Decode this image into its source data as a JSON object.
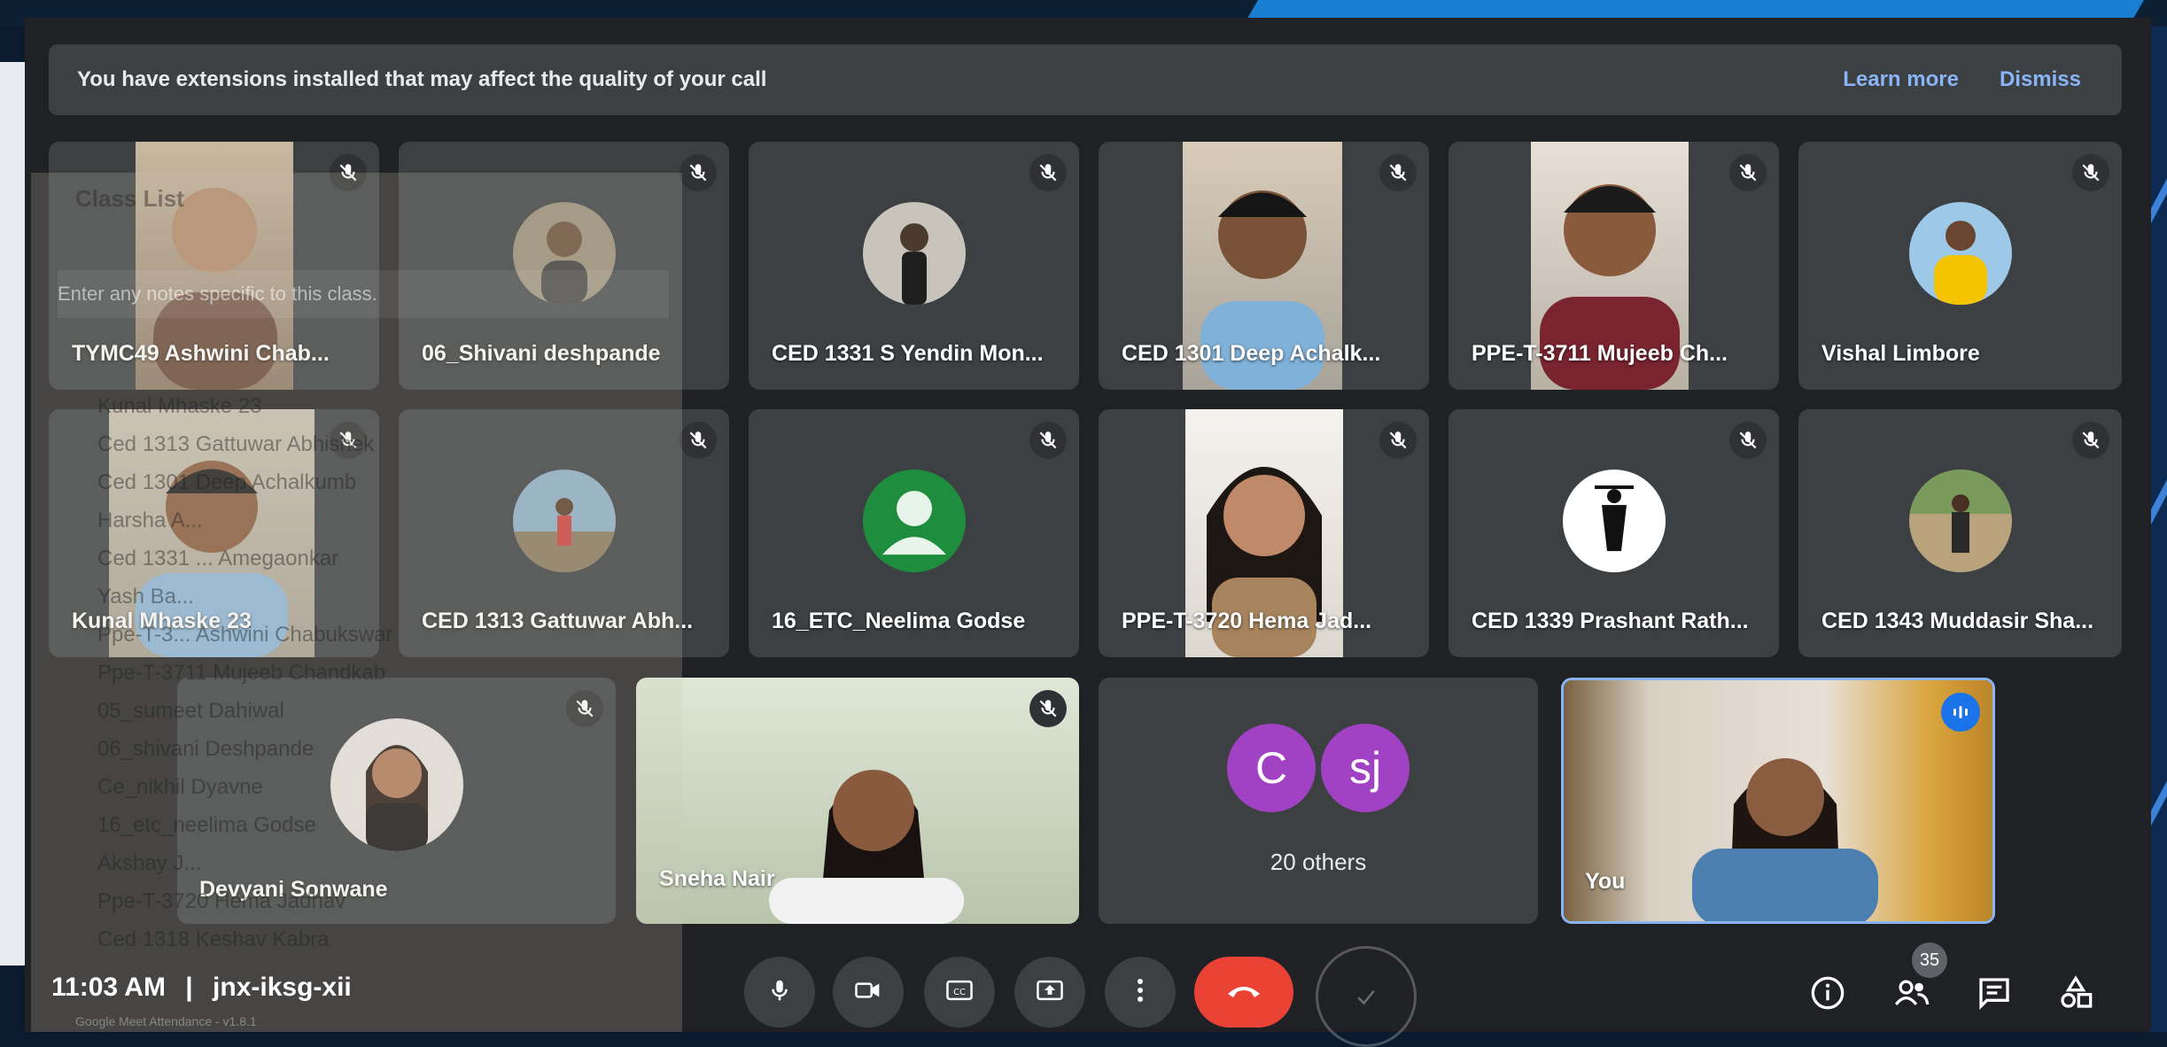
{
  "banner": {
    "message": "You have extensions installed that may affect the quality of your call",
    "learn_more": "Learn more",
    "dismiss": "Dismiss"
  },
  "participants": [
    {
      "name": "TYMC49 Ashwini Chab..."
    },
    {
      "name": "06_Shivani deshpande"
    },
    {
      "name": "CED 1331 S Yendin Mon..."
    },
    {
      "name": "CED 1301 Deep Achalk..."
    },
    {
      "name": "PPE-T-3711 Mujeeb Ch..."
    },
    {
      "name": "Vishal Limbore"
    },
    {
      "name": "Kunal Mhaske 23"
    },
    {
      "name": "CED 1313 Gattuwar Abh..."
    },
    {
      "name": "16_ETC_Neelima Godse"
    },
    {
      "name": "PPE-T-3720 Hema Jad..."
    },
    {
      "name": "CED 1339 Prashant Rath..."
    },
    {
      "name": "CED 1343 Muddasir Sha..."
    },
    {
      "name": "Devyani Sonwane"
    },
    {
      "name": "Sneha Nair"
    }
  ],
  "others": {
    "initials": [
      "C",
      "sj"
    ],
    "label": "20 others"
  },
  "self": {
    "name": "You"
  },
  "meeting": {
    "time": "11:03 AM",
    "separator": "|",
    "code": "jnx-iksg-xii"
  },
  "people_count": "35",
  "overlay": {
    "title": "Class List",
    "notes_placeholder": "Enter any notes specific to this class.",
    "rows": [
      "Kunal Mhaske 23",
      "Ced 1313 Gattuwar Abhishek",
      "Ced 1301 Deep Achalkumb",
      "Harsha A...",
      "Ced 1331 ... Amegaonkar",
      "Yash Ba...",
      "Ppe-T-3... Ashwini Chabukswar",
      "Ppe-T-3711 Mujeeb Chandkab",
      "05_sumeet Dahiwal",
      "06_shivani Deshpande",
      "Ce_nikhil Dyavne",
      "16_etc_neelima Godse",
      "Akshay J...",
      "Ppe-T-3720 Hema Jadhav",
      "Ced 1318 Keshav Kabra"
    ],
    "footer": "Google Meet Attendance - v1.8.1"
  },
  "colors": {
    "accent": "#8ab4f8",
    "hangup": "#ea4335",
    "tile": "#3c4043",
    "avatar_green": "#1e8e3e",
    "others_purple": "#a142c4"
  }
}
